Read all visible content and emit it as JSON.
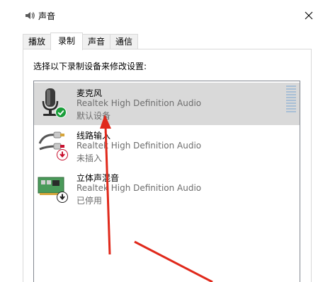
{
  "window": {
    "title": "声音",
    "icon": "speaker-icon",
    "close_icon": "close-icon"
  },
  "tabs": [
    {
      "label": "播放",
      "active": false
    },
    {
      "label": "录制",
      "active": true
    },
    {
      "label": "声音",
      "active": false
    },
    {
      "label": "通信",
      "active": false
    }
  ],
  "instruction": "选择以下录制设备来修改设置:",
  "devices": [
    {
      "name": "麦克风",
      "driver": "Realtek High Definition Audio",
      "status": "默认设备",
      "icon": "microphone-icon",
      "badge": "check-badge-icon",
      "badge_color": "#1a9e3a",
      "selected": true
    },
    {
      "name": "线路输入",
      "driver": "Realtek High Definition Audio",
      "status": "未插入",
      "icon": "line-in-cable-icon",
      "badge": "down-arrow-badge-icon",
      "badge_color": "#c8102e",
      "selected": false
    },
    {
      "name": "立体声混音",
      "driver": "Realtek High Definition Audio",
      "status": "已停用",
      "icon": "sound-card-icon",
      "badge": "down-arrow-badge-icon",
      "badge_color": "#222222",
      "selected": false
    }
  ],
  "annotation_color": "#e0291b"
}
